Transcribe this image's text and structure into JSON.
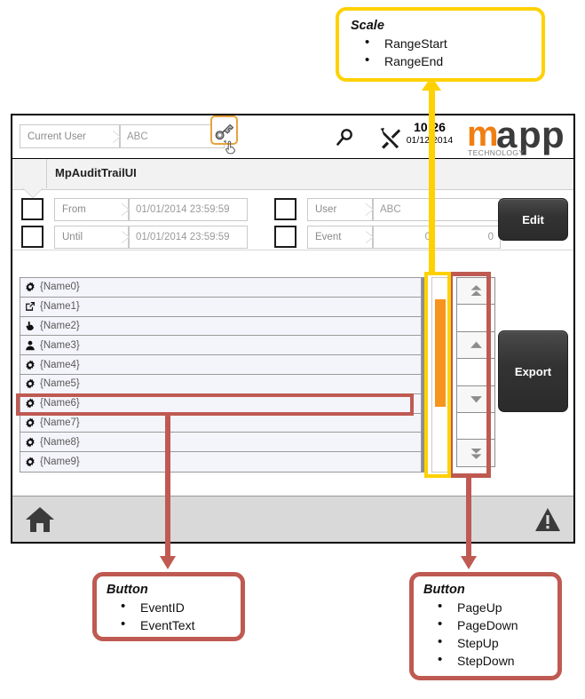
{
  "callouts": {
    "scale": {
      "title": "Scale",
      "items": [
        "RangeStart",
        "RangeEnd"
      ],
      "border_color": "#FFD100"
    },
    "event_button": {
      "title": "Button",
      "items": [
        "EventID",
        "EventText"
      ],
      "border_color": "#BF5A52"
    },
    "nav_button": {
      "title": "Button",
      "items": [
        "PageUp",
        "PageDown",
        "StepUp",
        "StepDown"
      ],
      "border_color": "#BF5A52"
    }
  },
  "header": {
    "user_label": "Current User",
    "user_value": "ABC",
    "key_icon": "key-icon",
    "search_icon": "search-icon",
    "tools_icon": "tools-icon",
    "cursor_icon": "hand-cursor-icon",
    "time": "10:26",
    "date": "01/12/2014",
    "logo_text": "mapp",
    "logo_sub": "TECHNOLOGY",
    "logo_accent": "#F07F13"
  },
  "tab": {
    "title": "MpAuditTrailUI"
  },
  "filters": {
    "rows": [
      {
        "label": "From",
        "value": "01/01/2014 23:59:59",
        "checked": false
      },
      {
        "label": "Until",
        "value": "01/01/2014 23:59:59",
        "checked": false
      }
    ],
    "rows_right": [
      {
        "label": "User",
        "value": "ABC",
        "value2": "",
        "checked": false
      },
      {
        "label": "Event",
        "value": "0",
        "value2": "0",
        "checked": false
      }
    ],
    "edit_label": "Edit"
  },
  "actions": {
    "export_label": "Export"
  },
  "list": {
    "rows": [
      {
        "icon": "gear-icon",
        "label": "{Name0}",
        "selected": false
      },
      {
        "icon": "external-link-icon",
        "label": "{Name1}",
        "selected": false
      },
      {
        "icon": "pointing-hand-icon",
        "label": "{Name2}",
        "selected": false
      },
      {
        "icon": "person-icon",
        "label": "{Name3}",
        "selected": false
      },
      {
        "icon": "gear-icon",
        "label": "{Name4}",
        "selected": false
      },
      {
        "icon": "gear-icon",
        "label": "{Name5}",
        "selected": false
      },
      {
        "icon": "gear-icon",
        "label": "{Name6}",
        "selected": true
      },
      {
        "icon": "gear-icon",
        "label": "{Name7}",
        "selected": false
      },
      {
        "icon": "gear-icon",
        "label": "{Name8}",
        "selected": false
      },
      {
        "icon": "gear-icon",
        "label": "{Name9}",
        "selected": false
      }
    ]
  },
  "scrollbar": {
    "thumb_color": "#F7941E"
  },
  "nav": {
    "buttons": [
      {
        "icon": "double-chevron-up-icon",
        "kind": "btn"
      },
      {
        "icon": "",
        "kind": "blank"
      },
      {
        "icon": "chevron-up-icon",
        "kind": "btn"
      },
      {
        "icon": "",
        "kind": "blank"
      },
      {
        "icon": "chevron-down-icon",
        "kind": "btn"
      },
      {
        "icon": "",
        "kind": "blank"
      },
      {
        "icon": "double-chevron-down-icon",
        "kind": "btn"
      }
    ]
  },
  "statusbar": {
    "home_icon": "home-icon",
    "warning_icon": "warning-icon"
  }
}
